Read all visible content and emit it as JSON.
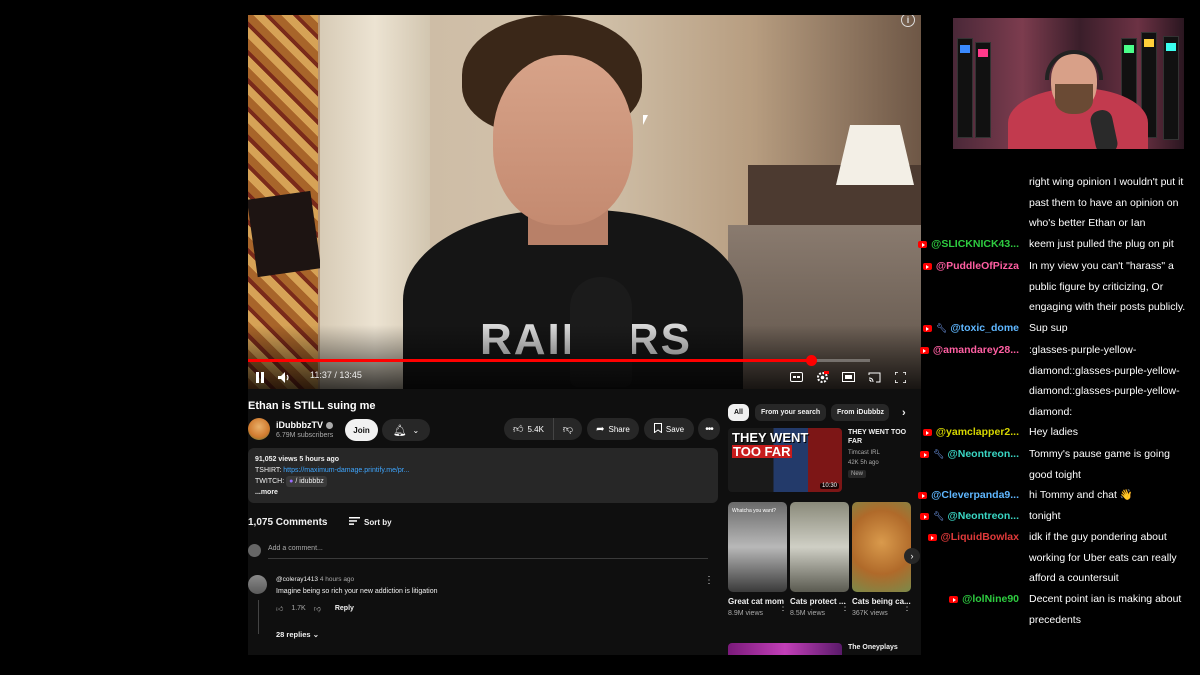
{
  "video": {
    "time": "11:37 / 13:45",
    "progress": 0.906,
    "shirt_text": "RAIDERS",
    "title": "Ethan is STILL suing me"
  },
  "channel": {
    "name": "iDubbbzTV",
    "subscribers": "6.79M subscribers",
    "join_label": "Join"
  },
  "actions": {
    "likes": "5.4K",
    "share": "Share",
    "save": "Save"
  },
  "description": {
    "views_time": "91,052 views  5 hours ago",
    "tshirt_label": "TSHIRT:",
    "tshirt_link": "https://maximum-damage.printify.me/pr...",
    "twitch_label": "TWITCH:",
    "twitch_value": "/ idubbbz",
    "more": "...more"
  },
  "comments": {
    "count": "1,075 Comments",
    "sort_by": "Sort by",
    "add_placeholder": "Add a comment...",
    "first": {
      "user": "@coleray1413",
      "time": "4 hours ago",
      "text": "Imagine being so rich your new addiction is litigation",
      "likes": "1.7K",
      "reply": "Reply",
      "replies": "28 replies"
    }
  },
  "sidebar": {
    "chips": [
      "All",
      "From your search",
      "From iDubbbz"
    ],
    "rec1": {
      "thumb_line1": "THEY WENT",
      "thumb_line2": "TOO FAR",
      "duration": "10:30",
      "title": "THEY WENT TOO FAR",
      "channel": "Timcast IRL",
      "meta": "42K  5h ago",
      "badge": "New"
    },
    "shorts": [
      {
        "title": "Great cat mom",
        "views": "8.9M views",
        "overlay": "Whatcha you want?"
      },
      {
        "title": "Cats protect ...",
        "views": "8.5M views",
        "overlay": ""
      },
      {
        "title": "Cats being ca...",
        "views": "367K views",
        "overlay": ""
      }
    ],
    "rec3": {
      "title": "The Oneyplays"
    }
  },
  "chat": {
    "messages": [
      {
        "user": "",
        "color": "#ffffff",
        "text": "right wing opinion I wouldn't put it past them to have an opinion on who's better Ethan or Ian",
        "icon": false,
        "mod": false
      },
      {
        "user": "@SLICKNICK43...",
        "color": "#2ecc40",
        "text": "keem just pulled the plug on pit",
        "icon": true,
        "mod": false
      },
      {
        "user": "@PuddleOfPizza",
        "color": "#ff5fa2",
        "text": "In my view you can't \"harass\" a public figure by criticizing, Or engaging with their posts publicly.",
        "icon": true,
        "mod": false
      },
      {
        "user": "@toxic_dome",
        "color": "#5fb7ff",
        "text": "Sup sup",
        "icon": true,
        "mod": true
      },
      {
        "user": "@amandarey28...",
        "color": "#ff5fa2",
        "text": ":glasses-purple-yellow-diamond::glasses-purple-yellow-diamond::glasses-purple-yellow-diamond:",
        "icon": true,
        "mod": false
      },
      {
        "user": "@yamclapper2...",
        "color": "#d6d600",
        "text": "Hey ladies",
        "icon": true,
        "mod": false
      },
      {
        "user": "@Neontreon...",
        "color": "#3ad6c4",
        "text": "Tommy's pause game is going good toight",
        "icon": true,
        "mod": true
      },
      {
        "user": "@Cleverpanda9...",
        "color": "#5fb7ff",
        "text": "hi Tommy and chat 👋",
        "icon": true,
        "mod": false
      },
      {
        "user": "@Neontreon...",
        "color": "#3ad6c4",
        "text": "tonight",
        "icon": true,
        "mod": true
      },
      {
        "user": "@LiquidBowlax",
        "color": "#e03a3a",
        "text": "idk if the guy pondering about working for Uber eats can really afford a countersuit",
        "icon": true,
        "mod": false
      },
      {
        "user": "@lolNine90",
        "color": "#2ecc40",
        "text": "Decent point ian is making about precedents",
        "icon": true,
        "mod": false
      }
    ]
  },
  "colors": {
    "accent_red": "#ff0000",
    "link_blue": "#3ea6ff",
    "bg_dark": "#0f0f0f"
  }
}
